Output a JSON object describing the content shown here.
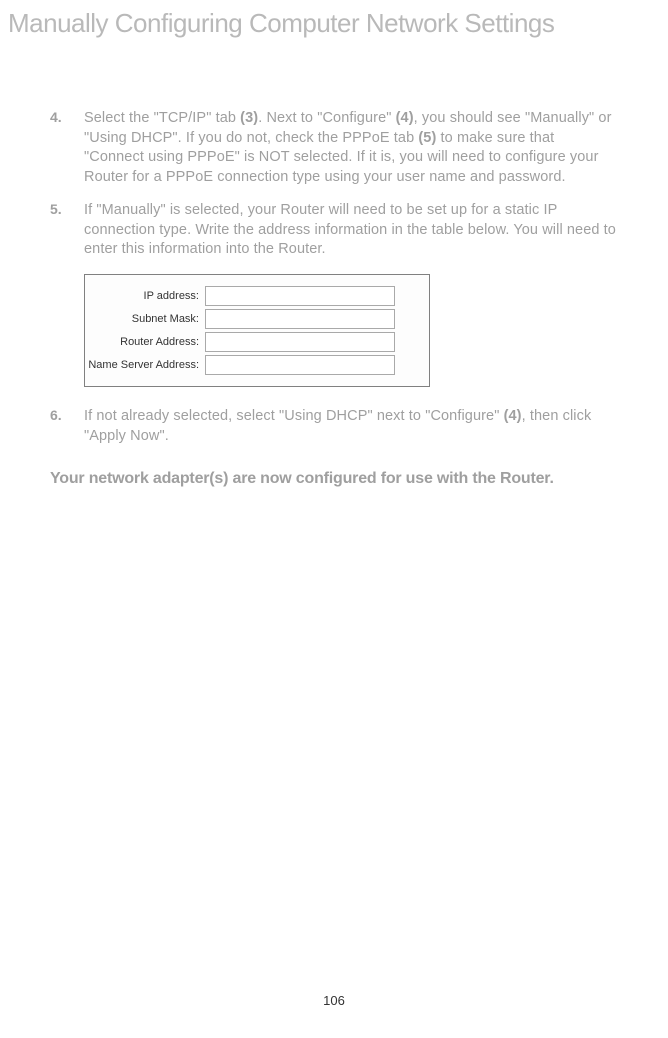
{
  "header": "Manually Configuring Computer Network Settings",
  "steps": {
    "s4": {
      "num": "4.",
      "t1": "Select the \"TCP/IP\" tab ",
      "b1": "(3)",
      "t2": ". Next to \"Configure\" ",
      "b2": "(4)",
      "t3": ", you should see \"Manually\" or \"Using DHCP\". If you do not, check the PPPoE tab ",
      "b3": "(5)",
      "t4": " to make sure that \"Connect using PPPoE\" is NOT selected. If it is, you will need to configure your Router for a PPPoE connection type using your user name and password."
    },
    "s5": {
      "num": "5.",
      "text": "If \"Manually\" is selected, your Router will need to be set up for a static IP connection type. Write the address information in the table below. You will need to enter this information into the Router."
    },
    "s6": {
      "num": "6.",
      "t1": "If not already selected, select \"Using DHCP\" next to \"Configure\" ",
      "b1": "(4)",
      "t2": ", then click \"Apply Now\"."
    }
  },
  "form": {
    "ip": "IP address:",
    "subnet": "Subnet Mask:",
    "router": "Router Address:",
    "ns": "Name Server Address:"
  },
  "conclusion": "Your network adapter(s) are now configured for use with the Router.",
  "pageNumber": "106"
}
